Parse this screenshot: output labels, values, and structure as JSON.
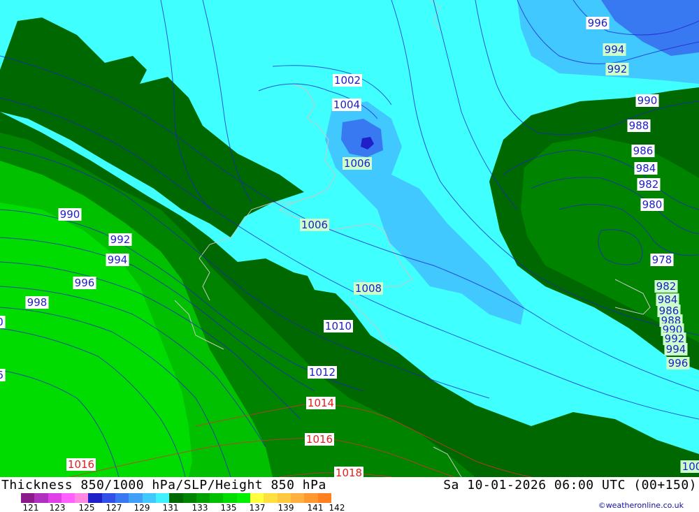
{
  "title": "Thickness 850/1000 hPa/SLP/Height 850 hPa",
  "valid_time": "Sa 10-01-2026 06:00 UTC (00+150)",
  "credit": "©weatheronline.co.uk",
  "legend": {
    "ticks": [
      "121",
      "123",
      "125",
      "127",
      "129",
      "131",
      "133",
      "135",
      "137",
      "139",
      "141",
      "142"
    ],
    "colors": [
      "#8b1a8b",
      "#b030c0",
      "#e040e8",
      "#ff60ff",
      "#ff88e0",
      "#2020c8",
      "#3050e8",
      "#3878f0",
      "#40a0f8",
      "#40c8ff",
      "#40f0ff",
      "#006800",
      "#008400",
      "#00a000",
      "#00c000",
      "#00dc00",
      "#00f000",
      "#ffff40",
      "#ffe040",
      "#ffc840",
      "#ffb040",
      "#ff9830",
      "#ff8020"
    ]
  },
  "isobars": [
    {
      "label": "996",
      "box": "#ffffff",
      "text": "#2020c8"
    },
    {
      "label": "994",
      "box": "#ccffcc",
      "text": "#2020c8"
    },
    {
      "label": "992",
      "box": "#ccffcc",
      "text": "#2020c8"
    },
    {
      "label": "1002",
      "box": "#ffffff",
      "text": "#2020c8"
    },
    {
      "label": "1004",
      "box": "#ffffff",
      "text": "#2020c8"
    },
    {
      "label": "990",
      "box": "#ffffff",
      "text": "#2020c8"
    },
    {
      "label": "988",
      "box": "#ffffff",
      "text": "#2020c8"
    },
    {
      "label": "986",
      "box": "#ffffff",
      "text": "#2020c8"
    },
    {
      "label": "984",
      "box": "#ffffff",
      "text": "#2020c8"
    },
    {
      "label": "982",
      "box": "#ffffff",
      "text": "#2020c8"
    },
    {
      "label": "980",
      "box": "#ffffff",
      "text": "#2020c8"
    },
    {
      "label": "1006",
      "box": "#ccffcc",
      "text": "#2020c8"
    },
    {
      "label": "1006",
      "box": "#ccffcc",
      "text": "#2020c8"
    },
    {
      "label": "990",
      "box": "#ffffff",
      "text": "#2020c8"
    },
    {
      "label": "992",
      "box": "#ffffff",
      "text": "#2020c8"
    },
    {
      "label": "994",
      "box": "#ffffff",
      "text": "#2020c8"
    },
    {
      "label": "996",
      "box": "#ffffff",
      "text": "#2020c8"
    },
    {
      "label": "998",
      "box": "#ffffff",
      "text": "#2020c8"
    },
    {
      "label": "1008",
      "box": "#ccffcc",
      "text": "#2020c8"
    },
    {
      "label": "978",
      "box": "#ffffff",
      "text": "#2020c8"
    },
    {
      "label": "982",
      "box": "#ccffcc",
      "text": "#2020c8"
    },
    {
      "label": "984",
      "box": "#ccffcc",
      "text": "#2020c8"
    },
    {
      "label": "986",
      "box": "#ccffcc",
      "text": "#2020c8"
    },
    {
      "label": "988",
      "box": "#ccffcc",
      "text": "#2020c8"
    },
    {
      "label": "990",
      "box": "#ccffcc",
      "text": "#2020c8"
    },
    {
      "label": "992",
      "box": "#ccffcc",
      "text": "#2020c8"
    },
    {
      "label": "994",
      "box": "#ccffcc",
      "text": "#2020c8"
    },
    {
      "label": "996",
      "box": "#ccffcc",
      "text": "#2020c8"
    },
    {
      "label": "1010",
      "box": "#ffffff",
      "text": "#2020c8"
    },
    {
      "label": "1012",
      "box": "#ffffff",
      "text": "#2020c8"
    },
    {
      "label": "1014",
      "box": "#ffffff",
      "text": "#e02020"
    },
    {
      "label": "1016",
      "box": "#ffffff",
      "text": "#e02020"
    },
    {
      "label": "1016",
      "box": "#ffffff",
      "text": "#e02020"
    },
    {
      "label": "1018",
      "box": "#ffffff",
      "text": "#e02020"
    },
    {
      "label": "100",
      "box": "#ccffcc",
      "text": "#2020c8"
    },
    {
      "label": "0",
      "box": "#ffffff",
      "text": "#2020c8"
    },
    {
      "label": "6",
      "box": "#ffffff",
      "text": "#2020c8"
    }
  ]
}
